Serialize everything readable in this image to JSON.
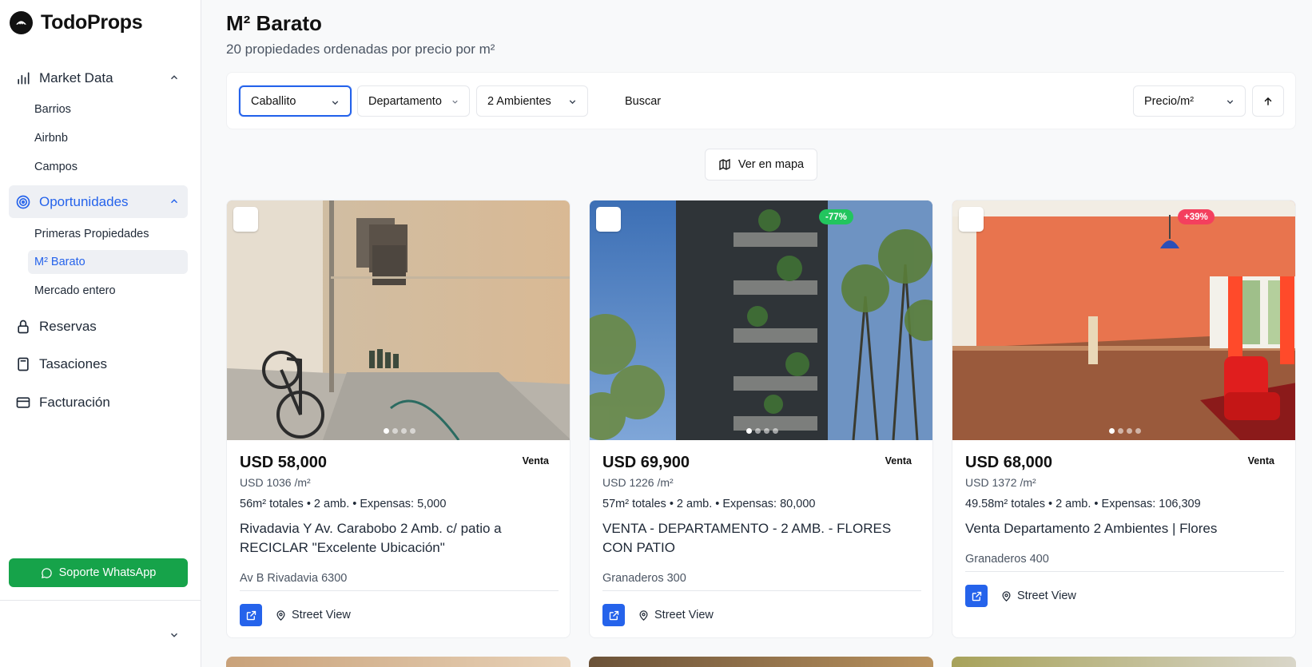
{
  "brand": {
    "name": "TodoProps"
  },
  "sidebar": {
    "market_data": {
      "label": "Market Data",
      "items": [
        "Barrios",
        "Airbnb",
        "Campos"
      ]
    },
    "oportunidades": {
      "label": "Oportunidades",
      "items": [
        "Primeras Propiedades",
        "M² Barato",
        "Mercado entero"
      ],
      "active_item": "M² Barato"
    },
    "reservas": "Reservas",
    "tasaciones": "Tasaciones",
    "facturacion": "Facturación",
    "whatsapp": "Soporte WhatsApp"
  },
  "page": {
    "title": "M² Barato",
    "subtitle": "20 propiedades ordenadas por precio por m²"
  },
  "filters": {
    "barrio": "Caballito",
    "tipo": "Departamento",
    "ambientes": "2 Ambientes",
    "buscar": "Buscar",
    "orden": "Precio/m²"
  },
  "map_button": "Ver en mapa",
  "cards": [
    {
      "price": "USD 58,000",
      "operation": "Venta",
      "price_per_m2": "USD 1036 /m²",
      "specs": "56m² totales • 2 amb. • Expensas: 5,000",
      "title": "Rivadavia Y Av. Carabobo 2 Amb. c/ patio a RECICLAR \"Excelente Ubicación\"",
      "address": "Av B Rivadavia 6300",
      "badge": "",
      "street_view": "Street View"
    },
    {
      "price": "USD 69,900",
      "operation": "Venta",
      "price_per_m2": "USD 1226 /m²",
      "specs": "57m² totales • 2 amb. • Expensas: 80,000",
      "title": "VENTA - DEPARTAMENTO - 2 AMB. - FLORES CON PATIO",
      "address": "Granaderos 300",
      "badge": "-77%",
      "street_view": "Street View"
    },
    {
      "price": "USD 68,000",
      "operation": "Venta",
      "price_per_m2": "USD 1372 /m²",
      "specs": "49.58m² totales • 2 amb. • Expensas: 106,309",
      "title": "Venta Departamento 2 Ambientes | Flores",
      "address": "Granaderos 400",
      "badge": "+39%",
      "street_view": "Street View"
    }
  ],
  "colors": {
    "accent": "#2563eb",
    "whatsapp": "#16a34a",
    "badge_negative": "#22c55e",
    "badge_positive": "#f43f5e"
  }
}
